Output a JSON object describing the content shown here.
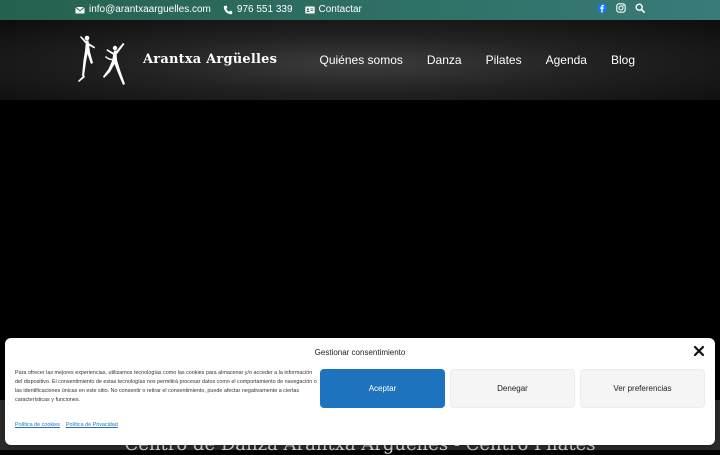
{
  "topbar": {
    "email": "info@arantxaarguelles.com",
    "phone": "976 551 339",
    "contact_label": "Contactar",
    "icons": [
      "envelope-icon",
      "phone-icon",
      "id-card-icon",
      "facebook-icon",
      "instagram-icon",
      "search-icon"
    ]
  },
  "header": {
    "brand": "Arantxa Argüelles",
    "nav": [
      "Quiénes somos",
      "Danza",
      "Pilates",
      "Agenda",
      "Blog"
    ]
  },
  "hero": {
    "title": "Centro de Danza Arantxa Argüelles - Centro Pilates"
  },
  "consent": {
    "title": "Gestionar consentimiento",
    "message": "Para ofrecer las mejores experiencias, utilizamos tecnologías como las cookies para almacenar y/o acceder a la información del dispositivo. El consentimiento de estas tecnologías nos permitirá procesar datos como el comportamiento de navegación o las identificaciones únicas en este sitio. No consentir o retirar el consentimiento, puede afectar negativamente a ciertas características y funciones.",
    "accept_label": "Aceptar",
    "deny_label": "Denegar",
    "prefs_label": "Ver preferencias",
    "cookie_policy": "Política de cookies",
    "privacy_policy": "Política de Privacidad"
  },
  "colors": {
    "topbar": "#2f6e63",
    "accent": "#1e73be",
    "header_bg": "#222222"
  }
}
